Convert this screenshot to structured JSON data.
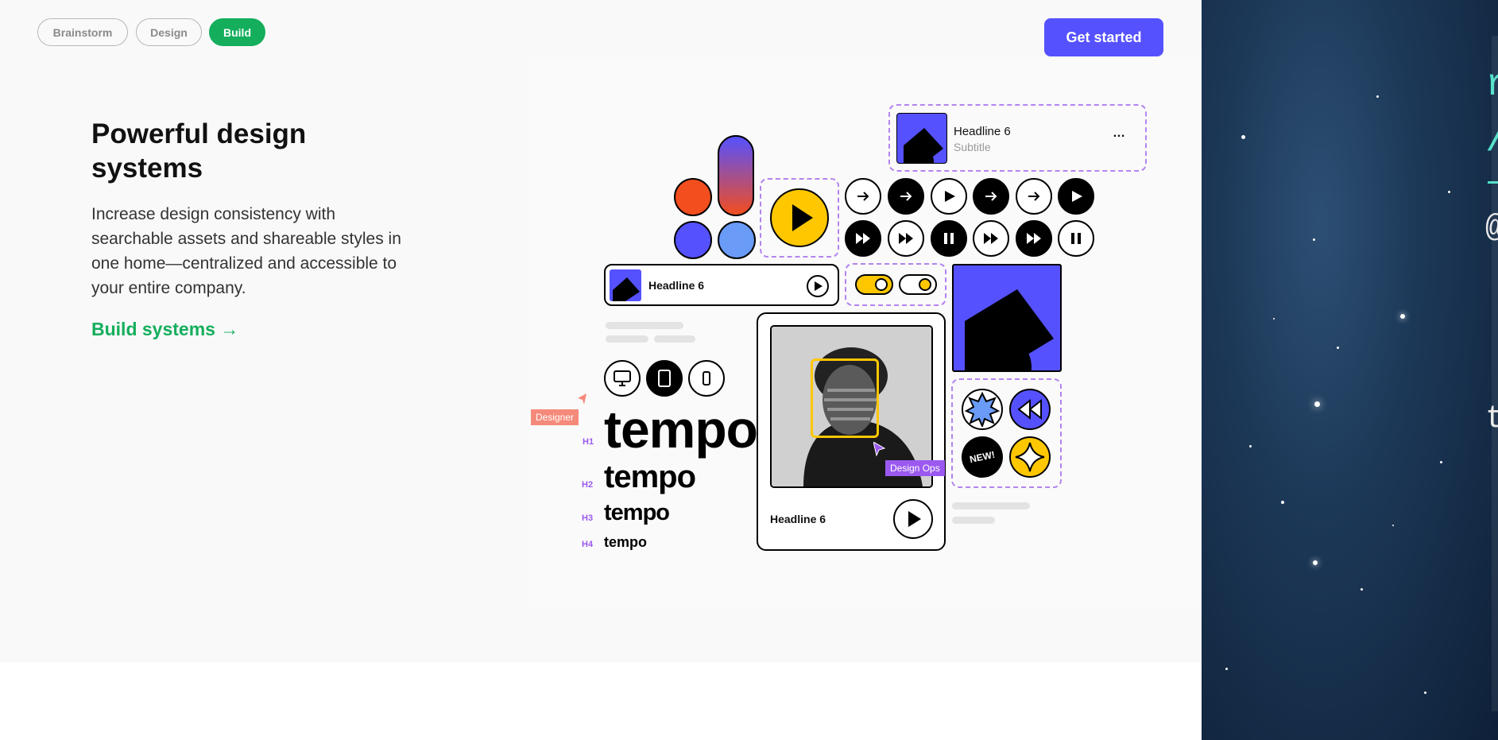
{
  "tabs": [
    {
      "label": "Brainstorm",
      "active": false
    },
    {
      "label": "Design",
      "active": false
    },
    {
      "label": "Build",
      "active": true
    }
  ],
  "cta_label": "Get started",
  "hero": {
    "title": "Powerful design systems",
    "body": "Increase design consistency with searchable assets and shareable styles in one home—centralized and accessible to your entire company.",
    "link": "Build systems →"
  },
  "illustration": {
    "media_card_top": {
      "title": "Headline 6",
      "subtitle": "Subtitle",
      "more": "…"
    },
    "media_row": {
      "title": "Headline 6"
    },
    "photo_card": {
      "title": "Headline 6"
    },
    "type_levels": [
      {
        "tag": "H1",
        "sample": "tempo"
      },
      {
        "tag": "H2",
        "sample": "tempo"
      },
      {
        "tag": "H3",
        "sample": "tempo"
      },
      {
        "tag": "H4",
        "sample": "tempo"
      }
    ],
    "cursor_labels": {
      "designer": "Designer",
      "design_ops": "Design Ops"
    },
    "badge": "NEW!"
  },
  "colors": {
    "brand_green": "#14ae5c",
    "brand_purple": "#5551ff",
    "accent_yellow": "#ffc700",
    "accent_orange": "#f24e1e",
    "accent_blue": "#699bf7",
    "dashed_purple": "#b384ef"
  },
  "desktop_glyphs": {
    "g1": "r",
    "g2": "/",
    "g3": "@",
    "g4": "t"
  }
}
